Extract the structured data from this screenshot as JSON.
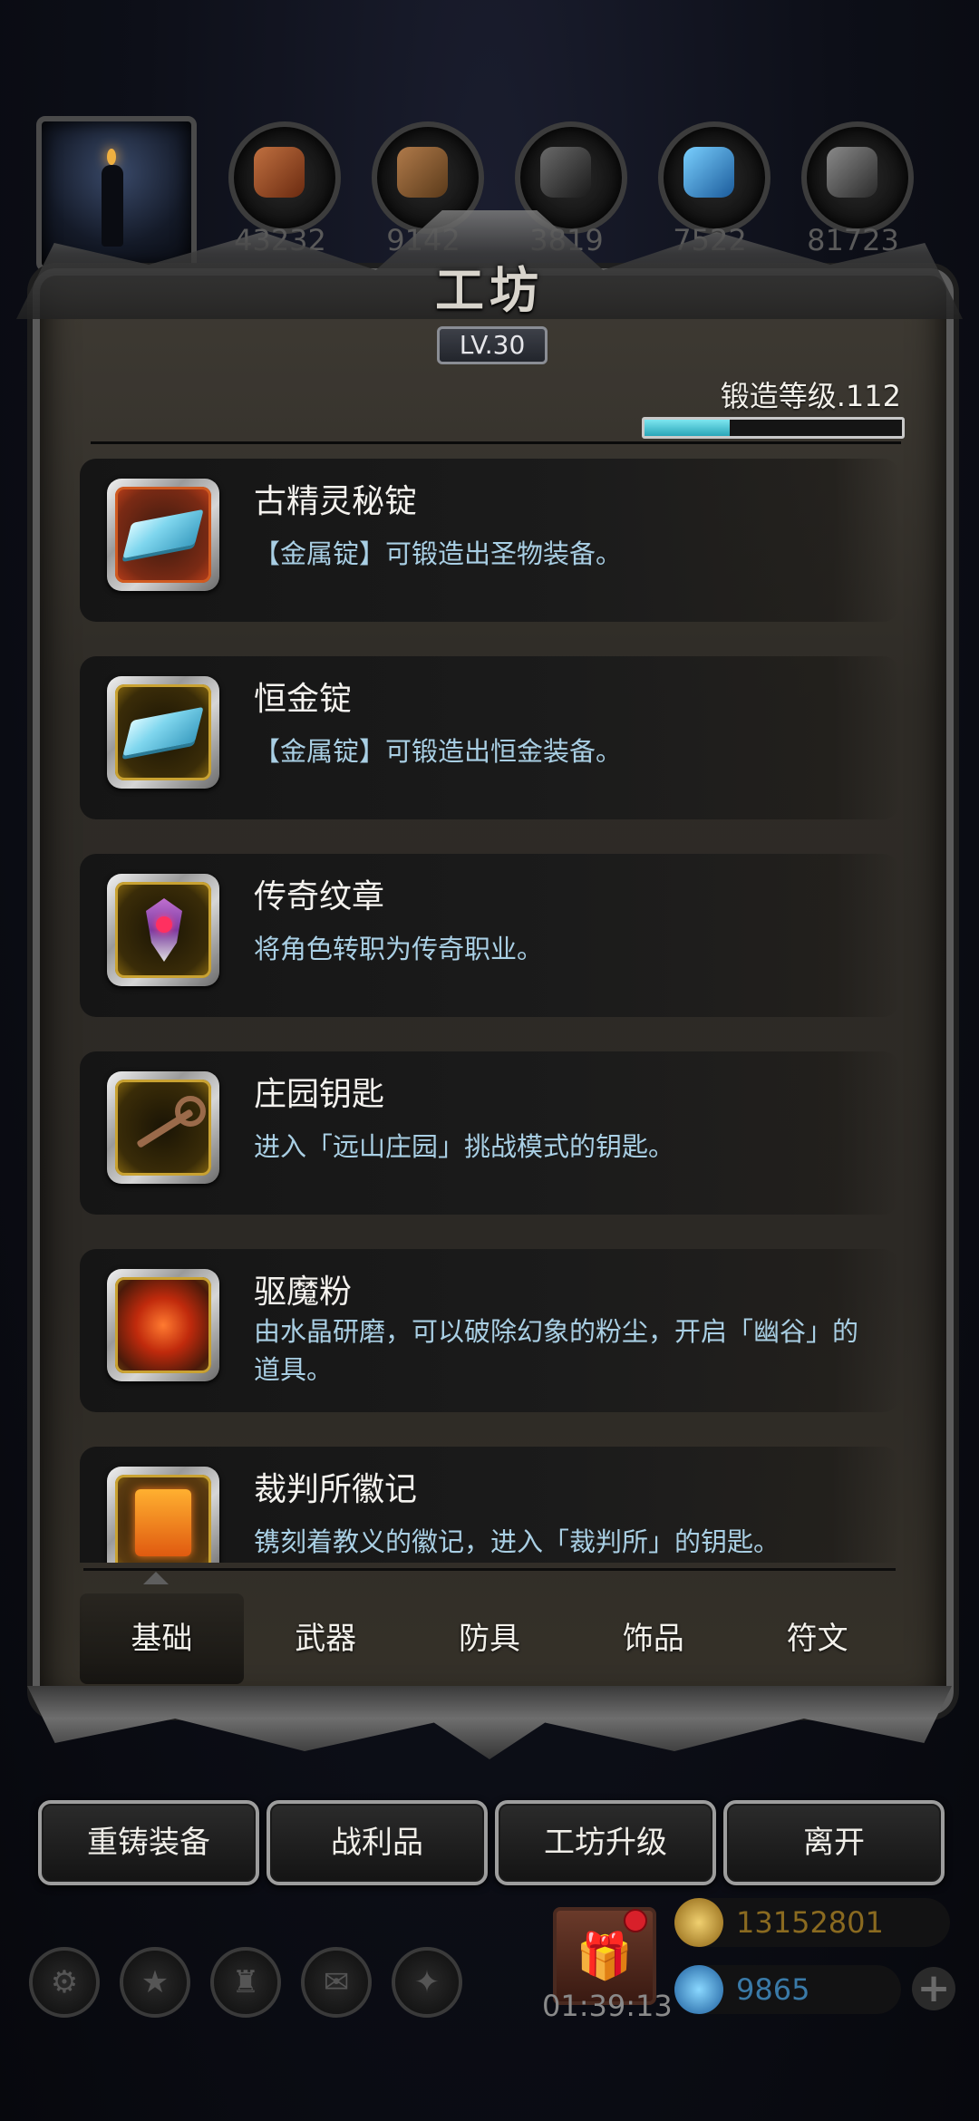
{
  "resources": {
    "counts": [
      "43232",
      "9142",
      "3819",
      "7522",
      "81723"
    ]
  },
  "panel": {
    "title": "工坊",
    "level": "LV.30",
    "forge_level": "锻造等级.112",
    "forge_progress": 0.33
  },
  "items": [
    {
      "name": "古精灵秘锭",
      "desc": "【金属锭】可锻造出圣物装备。"
    },
    {
      "name": "恒金锭",
      "desc": "【金属锭】可锻造出恒金装备。"
    },
    {
      "name": "传奇纹章",
      "desc": "将角色转职为传奇职业。"
    },
    {
      "name": "庄园钥匙",
      "desc": "进入「远山庄园」挑战模式的钥匙。"
    },
    {
      "name": "驱魔粉",
      "desc": "由水晶研磨，可以破除幻象的粉尘，开启「幽谷」的道具。"
    },
    {
      "name": "裁判所徽记",
      "desc": "镌刻着教义的徽记，进入「裁判所」的钥匙。"
    }
  ],
  "tabs": [
    "基础",
    "武器",
    "防具",
    "饰品",
    "符文"
  ],
  "actions": [
    "重铸装备",
    "战利品",
    "工坊升级",
    "离开"
  ],
  "bottom": {
    "timer": "01:39:13",
    "gold": "13152801",
    "gems": "9865",
    "plus": "+"
  },
  "colors": {
    "accent_cyan": "#2aa6b8",
    "desc_text": "#a9cfe4",
    "gold": "#c9a232"
  }
}
